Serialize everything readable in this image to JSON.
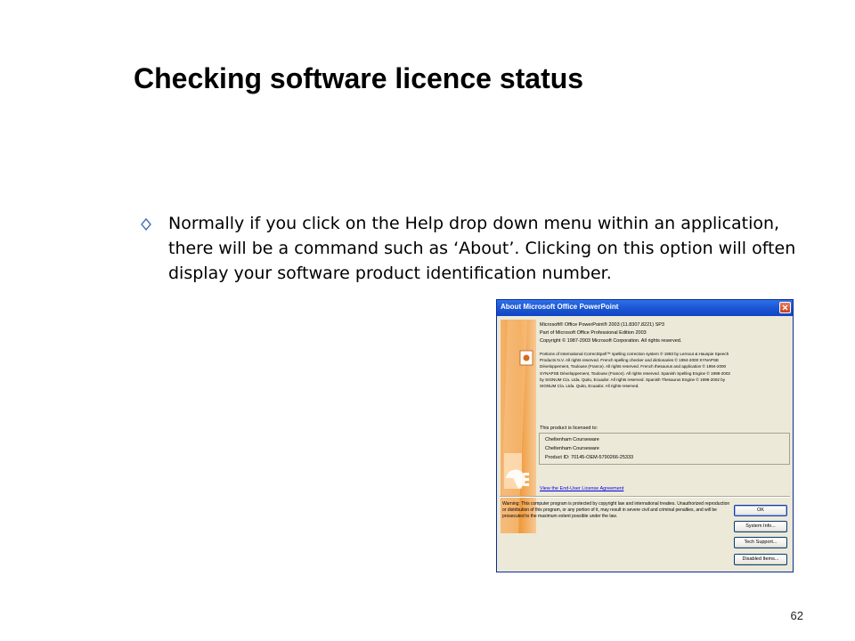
{
  "slide": {
    "title": "Checking software licence status",
    "bullet": "Normally if you click on the Help drop down menu within an application, there will be a command such as ‘About’. Clicking on this option will often display your software product identification number.",
    "page_number": "62"
  },
  "dialog": {
    "title": "About Microsoft Office PowerPoint",
    "product_line": "Microsoft® Office PowerPoint® 2003 (11.8307.8221)  SP3",
    "edition_line": "Part of Microsoft Office Professional Edition 2003",
    "copyright_line": "Copyright © 1987-2003 Microsoft Corporation.  All rights reserved.",
    "legal_text": "Portions of International CorrectSpell™ spelling correction system © 1993 by Lernout & Hauspie Speech\nProducts N.V. All rights reserved. French spelling checker and dictionaries © 1994-2000 SYNAPSE\nDéveloppement, Toulouse (France). All rights reserved. French thesaurus and application © 1994-2000\nSYNAPSE Développement, Toulouse (France). All rights reserved. Spanish Spelling Engine © 1998-2002\nby SIGNUM Cía. Ltda. Quito, Ecuador. All rights reserved. Spanish Thesaurus Engine © 1998-2002 by\nSIGNUM Cía. Ltda. Quito, Ecuador. All rights reserved.",
    "licensed_label": "This product is licensed to:",
    "licensee_line1": "Cheltenham Courseware",
    "licensee_line2": "Cheltenham Courseware",
    "product_id": "Product ID:   70145-OEM-5790266-25333",
    "eula_link": "View the End-User License Agreement",
    "warning_text": "Warning: This computer program is protected by copyright law and international treaties. Unauthorized reproduction or distribution of this program, or any portion of it, may result in severe civil and criminal penalties, and will be prosecuted to the maximum extent possible under the law.",
    "buttons": {
      "ok": "OK",
      "system_info": "System Info...",
      "tech_support": "Tech Support...",
      "disabled_items": "Disabled Items..."
    },
    "colors": {
      "titlebar": "#0f45c4",
      "face": "#ece9d8",
      "link": "#0000e0",
      "close_button": "#c7421c",
      "art_orange": "#f09a3c"
    }
  },
  "icons": {
    "bullet": "hollow-diamond-bullet-icon",
    "close": "close-icon",
    "app_logo": "powerpoint-logo-icon"
  }
}
